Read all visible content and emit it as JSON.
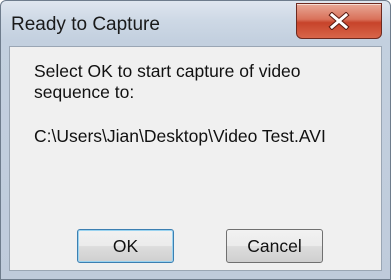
{
  "dialog": {
    "title": "Ready to Capture",
    "message": "Select OK to start capture of video sequence to:",
    "path": "C:\\Users\\Jian\\Desktop\\Video Test.AVI",
    "ok_label": "OK",
    "cancel_label": "Cancel"
  },
  "icons": {
    "close": "close-icon"
  },
  "colors": {
    "close_button": "#c7432a",
    "titlebar": "#cdd8e5",
    "client_bg": "#f0f0f0"
  }
}
